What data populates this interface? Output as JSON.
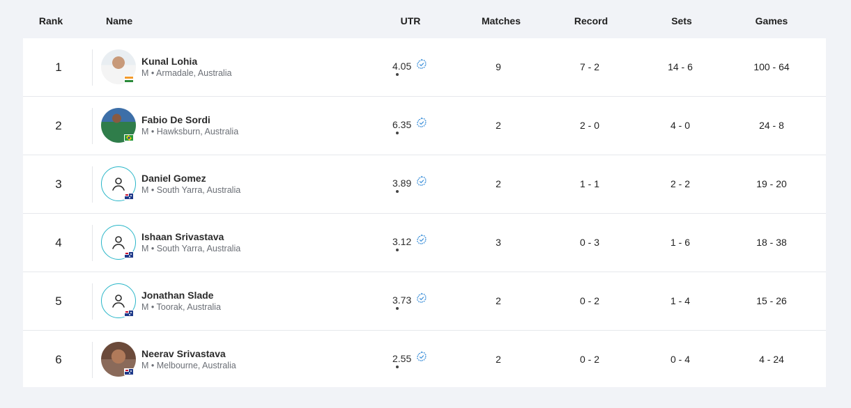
{
  "columns": {
    "rank": "Rank",
    "name": "Name",
    "utr": "UTR",
    "matches": "Matches",
    "record": "Record",
    "sets": "Sets",
    "games": "Games"
  },
  "colors": {
    "background": "#f1f3f7",
    "card": "#ffffff",
    "accent": "#29b6c8",
    "verify": "#3b8fd9"
  },
  "rows": [
    {
      "rank": "1",
      "name": "Kunal Lohia",
      "meta": "M • Armadale, Australia",
      "utr": "4.05",
      "matches": "9",
      "record": "7 - 2",
      "sets": "14 - 6",
      "games": "100 - 64",
      "avatar": "photo",
      "flag": "india-flag-icon"
    },
    {
      "rank": "2",
      "name": "Fabio De Sordi",
      "meta": "M • Hawksburn, Australia",
      "utr": "6.35",
      "matches": "2",
      "record": "2 - 0",
      "sets": "4 - 0",
      "games": "24 - 8",
      "avatar": "photo",
      "flag": "brazil-flag-icon"
    },
    {
      "rank": "3",
      "name": "Daniel Gomez",
      "meta": "M • South Yarra, Australia",
      "utr": "3.89",
      "matches": "2",
      "record": "1 - 1",
      "sets": "2 - 2",
      "games": "19 - 20",
      "avatar": "placeholder",
      "flag": "australia-flag-icon"
    },
    {
      "rank": "4",
      "name": "Ishaan Srivastava",
      "meta": "M • South Yarra, Australia",
      "utr": "3.12",
      "matches": "3",
      "record": "0 - 3",
      "sets": "1 - 6",
      "games": "18 - 38",
      "avatar": "placeholder",
      "flag": "australia-flag-icon"
    },
    {
      "rank": "5",
      "name": "Jonathan Slade",
      "meta": "M • Toorak, Australia",
      "utr": "3.73",
      "matches": "2",
      "record": "0 - 2",
      "sets": "1 - 4",
      "games": "15 - 26",
      "avatar": "placeholder",
      "flag": "australia-flag-icon"
    },
    {
      "rank": "6",
      "name": "Neerav Srivastava",
      "meta": "M • Melbourne, Australia",
      "utr": "2.55",
      "matches": "2",
      "record": "0 - 2",
      "sets": "0 - 4",
      "games": "4 - 24",
      "avatar": "photo",
      "flag": "australia-flag-icon"
    }
  ]
}
